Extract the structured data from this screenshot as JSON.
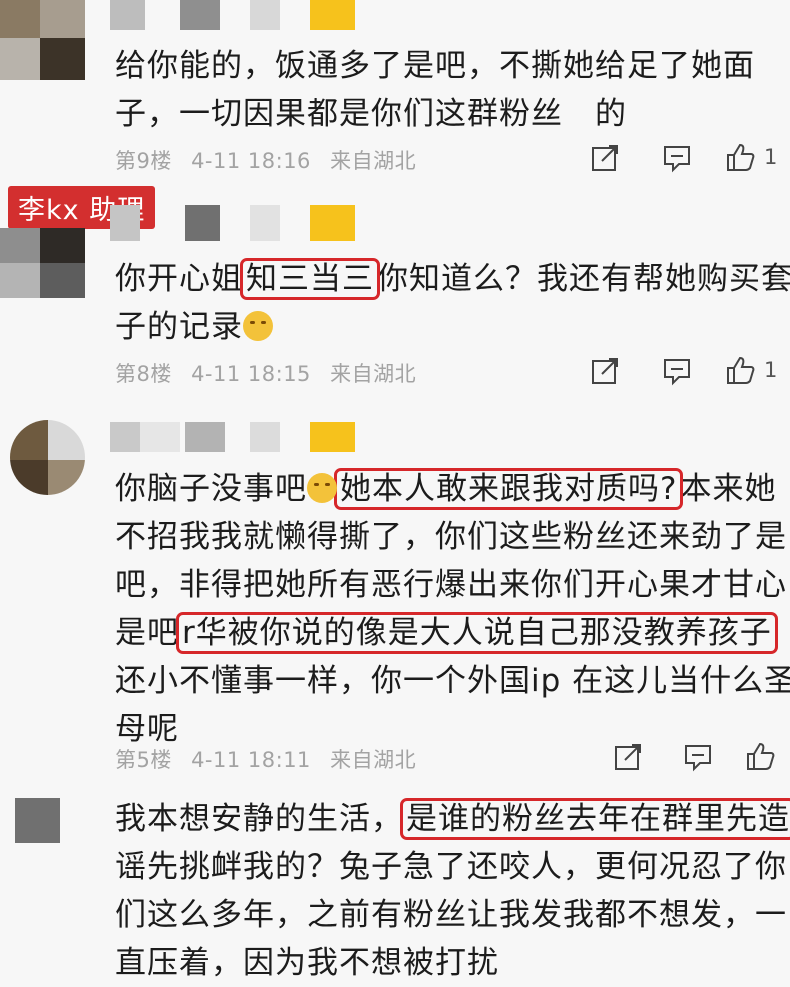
{
  "colors": {
    "highlight_box": "#d6272a",
    "assistant_tag": "#d32f2f",
    "meta_text": "#a3a3a3",
    "background": "#f7f7f7"
  },
  "assistant_tag": "李kx 助理",
  "comments": [
    {
      "text_lines": [
        [
          {
            "t": "给你能的，饭通多了是吧，不撕她给足了她面"
          }
        ],
        [
          {
            "t": "子，一切因果都是你们这群粉丝　的"
          }
        ]
      ],
      "floor": "第9楼",
      "time": "4-11 18:16",
      "location": "来自湖北",
      "likes": "1"
    },
    {
      "text_lines": [
        [
          {
            "t": "你开心姐"
          },
          {
            "t": "知三当三",
            "hl": true
          },
          {
            "t": "你知道么？我还有帮她购买套"
          }
        ],
        [
          {
            "t": "子的记录"
          },
          {
            "emoji": "smile-emoji"
          }
        ]
      ],
      "floor": "第8楼",
      "time": "4-11 18:15",
      "location": "来自湖北",
      "likes": "1"
    },
    {
      "text_lines": [
        [
          {
            "t": "你脑子没事吧"
          },
          {
            "emoji": "smile-emoji"
          },
          {
            "t": "她本人敢来跟我对质吗?",
            "hl": true
          },
          {
            "t": "本来她"
          }
        ],
        [
          {
            "t": "不招我我就懒得撕了，你们这些粉丝还来劲了是"
          }
        ],
        [
          {
            "t": "吧，非得把她所有恶行爆出来你们开心果才甘心"
          }
        ],
        [
          {
            "t": "是吧"
          },
          {
            "t": "r华被你说的像是大人说自己那没教养孩子",
            "hl": true
          }
        ],
        [
          {
            "t": "还小不懂事一样，你一个外国ip 在这儿当什么圣"
          }
        ],
        [
          {
            "t": "母呢"
          }
        ]
      ],
      "floor": "第5楼",
      "time": "4-11 18:11",
      "location": "来自湖北",
      "likes": ""
    },
    {
      "text_lines": [
        [
          {
            "t": "我本想安静的生活，"
          },
          {
            "t": "是谁的粉丝去年在群里先造",
            "hl": true
          }
        ],
        [
          {
            "t": "谣先挑衅我的？兔子急了还咬人，更何况忍了你"
          }
        ],
        [
          {
            "t": "们这么多年，之前有粉丝让我发我都不想发，一"
          }
        ],
        [
          {
            "t": "直压着，因为我不想被打扰"
          }
        ]
      ]
    }
  ]
}
